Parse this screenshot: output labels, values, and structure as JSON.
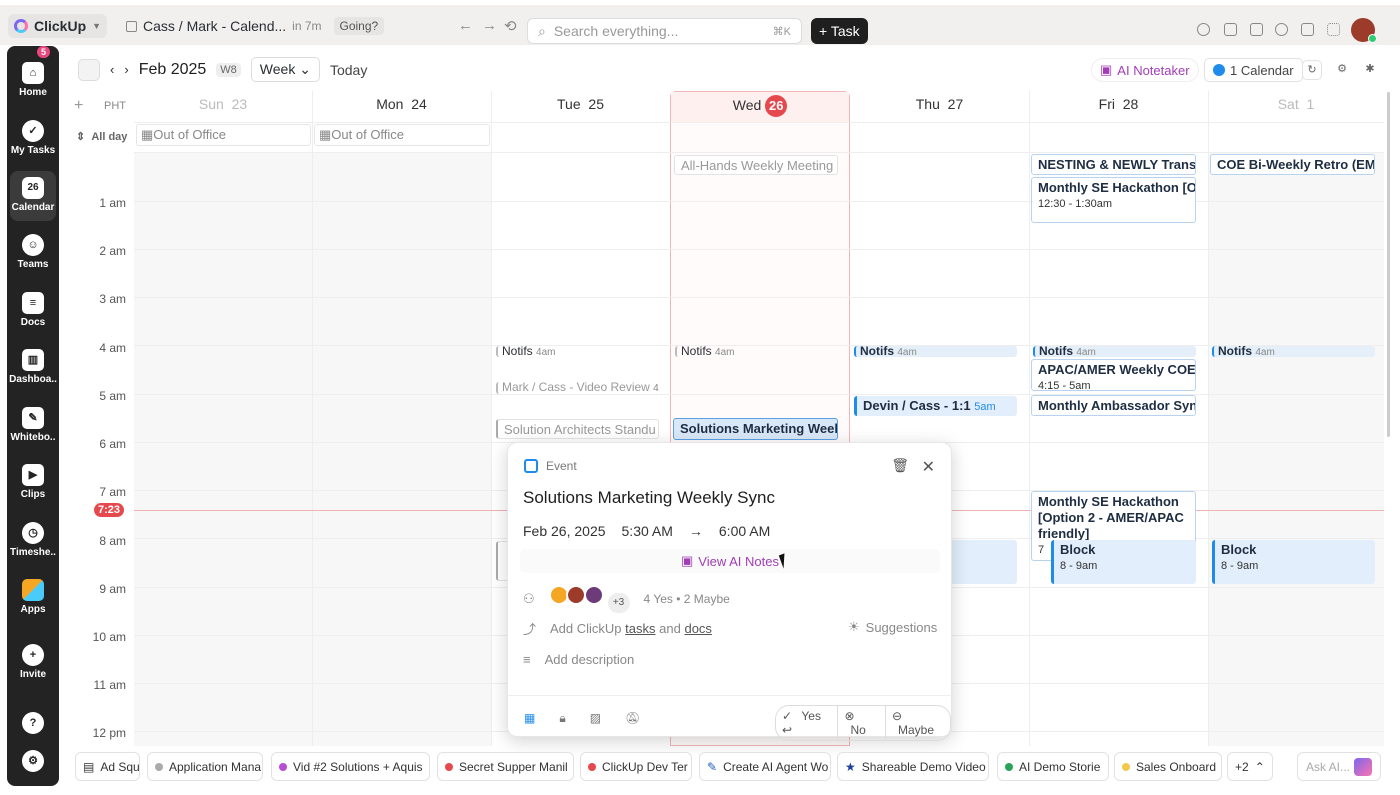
{
  "topbar": {
    "app_name": "ClickUp",
    "breadcrumb": "Cass / Mark - Calend...",
    "breadcrumb_time": "in 7m",
    "going_label": "Going?",
    "search_placeholder": "Search everything...",
    "search_shortcut": "⌘K",
    "task_button": "+ Task"
  },
  "sidebar": {
    "home_badge": "5",
    "items": [
      {
        "label": "Home",
        "icon": "home-icon"
      },
      {
        "label": "My Tasks",
        "icon": "check-circle-icon"
      },
      {
        "label": "Calendar",
        "icon": "calendar-icon",
        "icon_text": "26"
      },
      {
        "label": "Teams",
        "icon": "teams-icon"
      },
      {
        "label": "Docs",
        "icon": "docs-icon"
      },
      {
        "label": "Dashboa..",
        "icon": "dashboard-icon"
      },
      {
        "label": "Whitebo..",
        "icon": "whiteboard-icon"
      },
      {
        "label": "Clips",
        "icon": "clips-icon"
      },
      {
        "label": "Timeshe..",
        "icon": "timesheet-icon"
      },
      {
        "label": "Apps",
        "icon": "apps-icon"
      },
      {
        "label": "Invite",
        "icon": "invite-icon"
      }
    ]
  },
  "toolbar": {
    "month": "Feb 2025",
    "week_badge": "W8",
    "view": "Week",
    "today": "Today",
    "ai_notetaker": "AI Notetaker",
    "calendar_count": "1 Calendar"
  },
  "calendar": {
    "timezone": "PHT",
    "allday_label": "All day",
    "days": [
      {
        "name": "Sun",
        "num": "23"
      },
      {
        "name": "Mon",
        "num": "24"
      },
      {
        "name": "Tue",
        "num": "25"
      },
      {
        "name": "Wed",
        "num": "26"
      },
      {
        "name": "Thu",
        "num": "27"
      },
      {
        "name": "Fri",
        "num": "28"
      },
      {
        "name": "Sat",
        "num": "1"
      }
    ],
    "allday_events": [
      "Out of Office",
      "Out of Office"
    ],
    "hours": [
      "1 am",
      "2 am",
      "3 am",
      "4 am",
      "5 am",
      "6 am",
      "7 am",
      "8 am",
      "9 am",
      "10 am",
      "11 am",
      "12 pm"
    ],
    "now": "7:23",
    "events": {
      "wed_allhands": "All-Hands Weekly Meeting",
      "fri_nesting": "NESTING & NEWLY Transit",
      "sat_coe": "COE Bi-Weekly Retro (EME",
      "fri_hackathon1": "Monthly SE Hackathon [Op",
      "fri_hackathon1_time": "12:30 - 1:30am",
      "notifs": "Notifs",
      "notifs_time": "4am",
      "fri_apac": "APAC/AMER Weekly COE T",
      "fri_apac_time": "4:15 - 5am",
      "tue_review": "Mark / Cass - Video Review",
      "tue_review_num": "4",
      "thu_devin": "Devin / Cass - 1:1",
      "thu_devin_time": "5am",
      "fri_ambassador": "Monthly Ambassador Sync",
      "tue_standup": "Solution Architects Standu",
      "wed_solutions": "Solutions Marketing Weekl",
      "fri_hackathon2": "Monthly SE Hackathon [Option 2 - AMER/APAC friendly]",
      "fri_hackathon2_num": "7",
      "block": "Block",
      "block_time": "8 - 9am"
    }
  },
  "popup": {
    "type": "Event",
    "title": "Solutions Marketing Weekly Sync",
    "date": "Feb 26, 2025",
    "start": "5:30 AM",
    "end": "6:00 AM",
    "ai_notes": "View AI Notes",
    "attendee_more": "+3",
    "attendee_summary": "4 Yes • 2 Maybe",
    "add_prefix": "Add ClickUp",
    "add_tasks": "tasks",
    "add_and": "and",
    "add_docs": "docs",
    "suggestions": "Suggestions",
    "description_placeholder": "Add description",
    "rsvp": [
      "Yes",
      "No",
      "Maybe"
    ]
  },
  "bottom_tabs": [
    {
      "label": "Ad Squ",
      "color": "#888888"
    },
    {
      "label": "Application Mana",
      "color": "#aaaaaa"
    },
    {
      "label": "Vid #2 Solutions + Aquis",
      "color": "#b84ed1"
    },
    {
      "label": "Secret Supper Manil",
      "color": "#e5484d"
    },
    {
      "label": "ClickUp Dev Ter",
      "color": "#e5484d"
    },
    {
      "label": "Create AI Agent Wo",
      "color": "#1f5fbf"
    },
    {
      "label": "Shareable Demo Video",
      "color": "#1f3fa0"
    },
    {
      "label": "AI Demo Storie",
      "color": "#27a35a"
    },
    {
      "label": "Sales Onboard",
      "color": "#f2c94c"
    },
    {
      "label": "+2",
      "color": ""
    }
  ],
  "ask_ai_placeholder": "Ask AI..."
}
